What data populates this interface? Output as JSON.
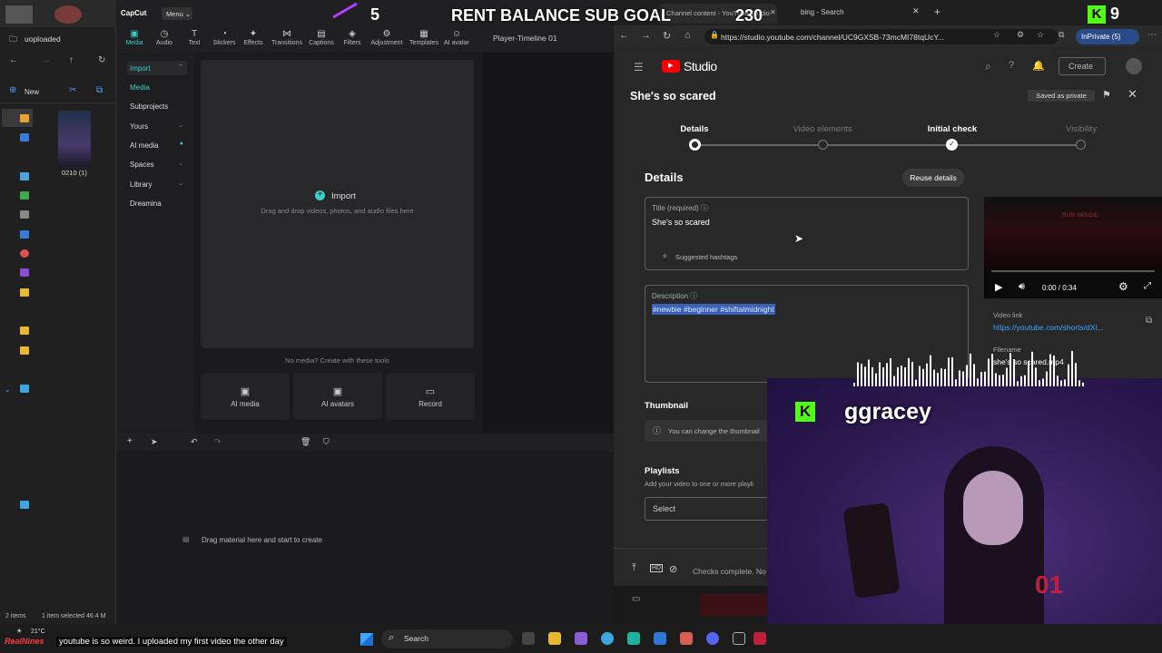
{
  "explorer": {
    "path": "uoploaded",
    "new_label": "New",
    "file_name": "0210 (1)",
    "status_items": "2 items",
    "status_selected": "1 item selected  46.4 M"
  },
  "capcut": {
    "logo": "CapCut",
    "menu_label": "Menu",
    "tools": [
      "Media",
      "Audio",
      "Text",
      "Stickers",
      "Effects",
      "Transitions",
      "Captions",
      "Filters",
      "Adjustment",
      "Templates",
      "AI avatar"
    ],
    "player_title": "Player-Timeline 01",
    "side_items": [
      "Import",
      "Media",
      "Subprojects",
      "Yours",
      "AI media",
      "Spaces",
      "Library",
      "Dreamina"
    ],
    "import_label": "Import",
    "drag_hint": "Drag and drop videos, photos, and audio files here",
    "no_media_hint": "No media? Create with these tools",
    "tile_ai_media": "AI media",
    "tile_ai_avatars": "AI avatars",
    "tile_record": "Record",
    "timeline_hint": "Drag material here and start to create"
  },
  "browser": {
    "tab1_title": "Channel content - YouTube Studio",
    "tab2_title": "bing - Search",
    "url": "https://studio.youtube.com/channel/UC9GXSB-73mcMI78tqUcY...",
    "inprivate_label": "InPrivate (5)"
  },
  "yt": {
    "studio_label": "Studio",
    "create_label": "Create",
    "video_title": "She's so scared",
    "saved_label": "Saved as private",
    "steps": [
      "Details",
      "Video elements",
      "Initial check",
      "Visibility"
    ],
    "details_heading": "Details",
    "reuse_label": "Reuse details",
    "title_label": "Title (required)",
    "title_value": "She's so scared",
    "hashtags_label": "Suggested hashtags",
    "desc_label": "Description",
    "desc_value": "#newbie #beginner #shiftatmidnight",
    "thumbnail_heading": "Thumbnail",
    "thumbnail_hint": "You can change the thumbnail",
    "playlists_heading": "Playlists",
    "playlists_hint": "Add your video to one or more playli",
    "select_label": "Select",
    "video_time": "0:00 / 0:34",
    "video_overlay_text": "RUN INSIDE",
    "video_link_label": "Video link",
    "video_link": "https://youtube.com/shorts/dXl...",
    "filename_label": "Filename",
    "filename": "she's so scared.mp4",
    "checks_text": "Checks complete. No"
  },
  "stream": {
    "goal_count_left": "5",
    "goal_text": "RENT BALANCE SUB GOAL",
    "goal_count_right": "230",
    "kick_count": "9",
    "streamer_name": "ggracey",
    "ticker": "youtube is so weird. I uploaded my first video the other day",
    "ticker_tag": "RealNines",
    "weather": "21°C"
  },
  "taskbar": {
    "search_label": "Search"
  },
  "colors": {
    "accent_capcut": "#35d1c8",
    "yt_red": "#ff0000",
    "kick_green": "#53fc18",
    "link_blue": "#3ea6ff",
    "purple": "#5b2fa0"
  }
}
